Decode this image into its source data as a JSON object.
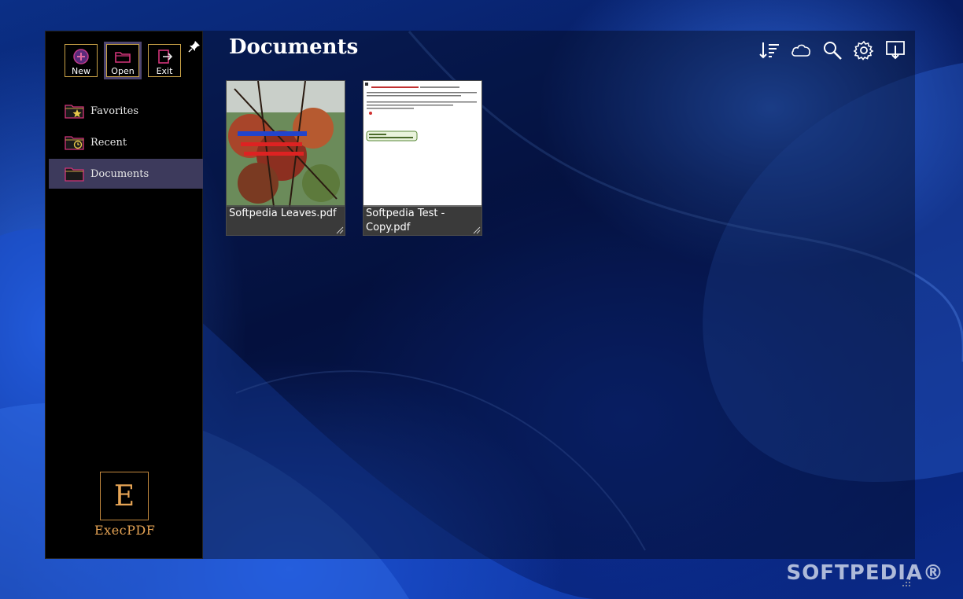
{
  "toolbar": {
    "new_label": "New",
    "open_label": "Open",
    "exit_label": "Exit"
  },
  "nav": {
    "items": [
      {
        "label": "Favorites",
        "selected": false
      },
      {
        "label": "Recent",
        "selected": false
      },
      {
        "label": "Documents",
        "selected": true
      }
    ]
  },
  "main": {
    "title": "Documents",
    "tools": [
      "sort-icon",
      "cloud-icon",
      "search-icon",
      "gear-icon",
      "download-icon"
    ],
    "files": [
      {
        "name": "Softpedia Leaves.pdf"
      },
      {
        "name": "Softpedia Test - Copy.pdf"
      }
    ]
  },
  "logo": {
    "letter": "E",
    "text": "ExecPDF"
  },
  "watermark": "SOFTPEDIA®",
  "colors": {
    "accent_gold": "#c9a247",
    "selected_bg": "#3d3a5c",
    "logo_orange": "#e6a455"
  }
}
